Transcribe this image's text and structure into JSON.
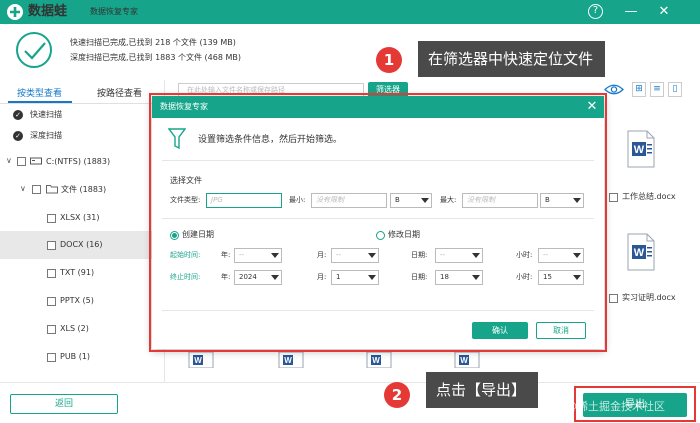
{
  "app": {
    "name": "数据蛙",
    "subtitle": "数据恢复专家"
  },
  "window_controls": {
    "help": "?",
    "minimize": "—",
    "close": "✕"
  },
  "status": {
    "line1": "快速扫描已完成,已找到 218 个文件 (139 MB)",
    "line2": "深度扫描已完成,已找到 1883 个文件 (468 MB)"
  },
  "tabs": {
    "by_type": "按类型查看",
    "by_path": "按路径查看"
  },
  "tree": {
    "quick_scan": "快速扫描",
    "deep_scan": "深度扫描",
    "drive": "C:(NTFS) (1883)",
    "folder": "文件 (1883)",
    "types": [
      "XLSX (31)",
      "DOCX (16)",
      "TXT (91)",
      "PPTX (5)",
      "XLS (2)",
      "PUB (1)"
    ]
  },
  "search": {
    "placeholder": "在此处输入文件名称或保存路径"
  },
  "filter_button": "筛选器",
  "files": [
    "工作总结.docx",
    "实习证明.docx"
  ],
  "callouts": {
    "step1_num": "1",
    "step1_text": "在筛选器中快速定位文件",
    "step2_num": "2",
    "step2_text": "点击【导出】"
  },
  "dialog": {
    "title": "数据恢复专家",
    "intro": "设置筛选条件信息，然后开始筛选。",
    "section_file": "选择文件",
    "file_type_label": "文件类型:",
    "file_type_placeholder": "JPG",
    "min_label": "最小:",
    "min_placeholder": "没有限制",
    "min_unit": "B",
    "max_label": "最大:",
    "max_placeholder": "没有限制",
    "max_unit": "B",
    "radio_created": "创建日期",
    "radio_modified": "修改日期",
    "start_label": "起始时间:",
    "end_label": "终止时间:",
    "year_label": "年:",
    "month_label": "月:",
    "day_label": "日期:",
    "hour_label": "小时:",
    "start": {
      "year": "--",
      "month": "--",
      "day": "--",
      "hour": "--"
    },
    "end": {
      "year": "2024",
      "month": "1",
      "day": "18",
      "hour": "15"
    },
    "ok": "确认",
    "cancel": "取消"
  },
  "bottom": {
    "back": "返回",
    "export": "导出"
  },
  "watermark": "@稀土掘金技术社区",
  "colors": {
    "brand": "#16a58a",
    "highlight": "#e53935",
    "tab_active": "#1679c8",
    "callout_bg": "#4a4a4a"
  }
}
